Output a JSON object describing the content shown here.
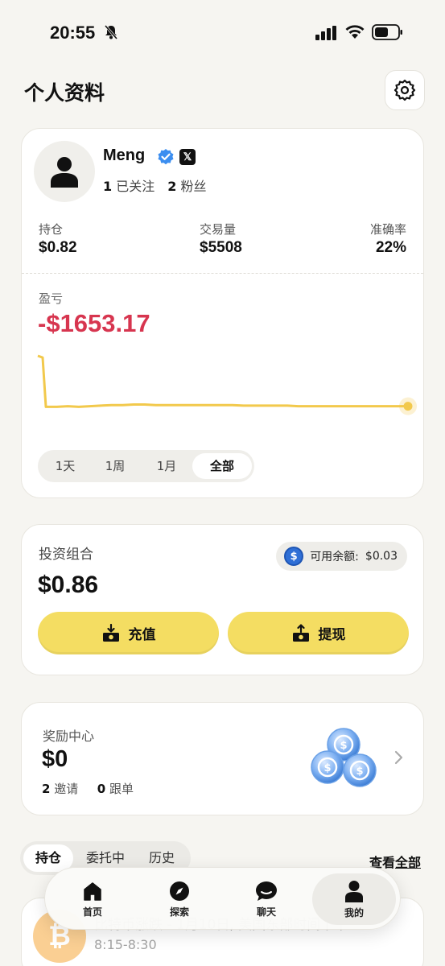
{
  "status_bar": {
    "time": "20:55"
  },
  "header": {
    "title": "个人资料"
  },
  "profile": {
    "username": "Meng",
    "x_badge": "𝕏",
    "following_count": "1",
    "following_label": "已关注",
    "followers_count": "2",
    "followers_label": "粉丝"
  },
  "stats": {
    "holdings": {
      "label": "持仓",
      "value": "$0.82"
    },
    "volume": {
      "label": "交易量",
      "value": "$5508"
    },
    "accuracy": {
      "label": "准确率",
      "value": "22%"
    }
  },
  "pnl": {
    "label": "盈亏",
    "value": "-$1653.17"
  },
  "range_tabs": [
    "1天",
    "1周",
    "1月",
    "全部"
  ],
  "range_selected": "全部",
  "chart_data": {
    "type": "line",
    "title": "",
    "xlabel": "",
    "ylabel": "",
    "values": [
      1.0,
      0.97,
      0.12,
      0.12,
      0.13,
      0.12,
      0.13,
      0.14,
      0.15,
      0.15,
      0.16,
      0.16,
      0.15,
      0.15,
      0.15,
      0.15,
      0.15,
      0.15,
      0.15,
      0.15,
      0.14,
      0.14,
      0.14,
      0.14,
      0.14,
      0.13,
      0.13,
      0.13,
      0.13,
      0.13,
      0.13,
      0.13,
      0.13,
      0.13,
      0.13,
      0.13
    ],
    "series_color": "#f2c94c",
    "grid": false
  },
  "portfolio": {
    "title": "投资组合",
    "balance_label": "可用余额:",
    "balance_value": "$0.03",
    "value": "$0.86",
    "deposit_label": "充值",
    "withdraw_label": "提现"
  },
  "rewards": {
    "title": "奖励中心",
    "value": "$0",
    "invites_count": "2",
    "invites_label": "邀请",
    "copy_count": "0",
    "copy_label": "跟单"
  },
  "position_tabs": [
    "持仓",
    "委托中",
    "历史"
  ],
  "position_selected": "持仓",
  "view_all": {
    "prefix": "查看",
    "link": "全部"
  },
  "peek": {
    "title": "比特币涨跌 - 1月10日, 美国东部时间下午",
    "time": "8:15-8:30"
  },
  "nav": [
    {
      "label": "首页",
      "icon": "home-icon"
    },
    {
      "label": "探索",
      "icon": "compass-icon"
    },
    {
      "label": "聊天",
      "icon": "chat-icon"
    },
    {
      "label": "我的",
      "icon": "person-icon"
    }
  ],
  "colors": {
    "accent": "#f4dd62",
    "loss": "#d7354f",
    "background": "#f6f5f1"
  }
}
